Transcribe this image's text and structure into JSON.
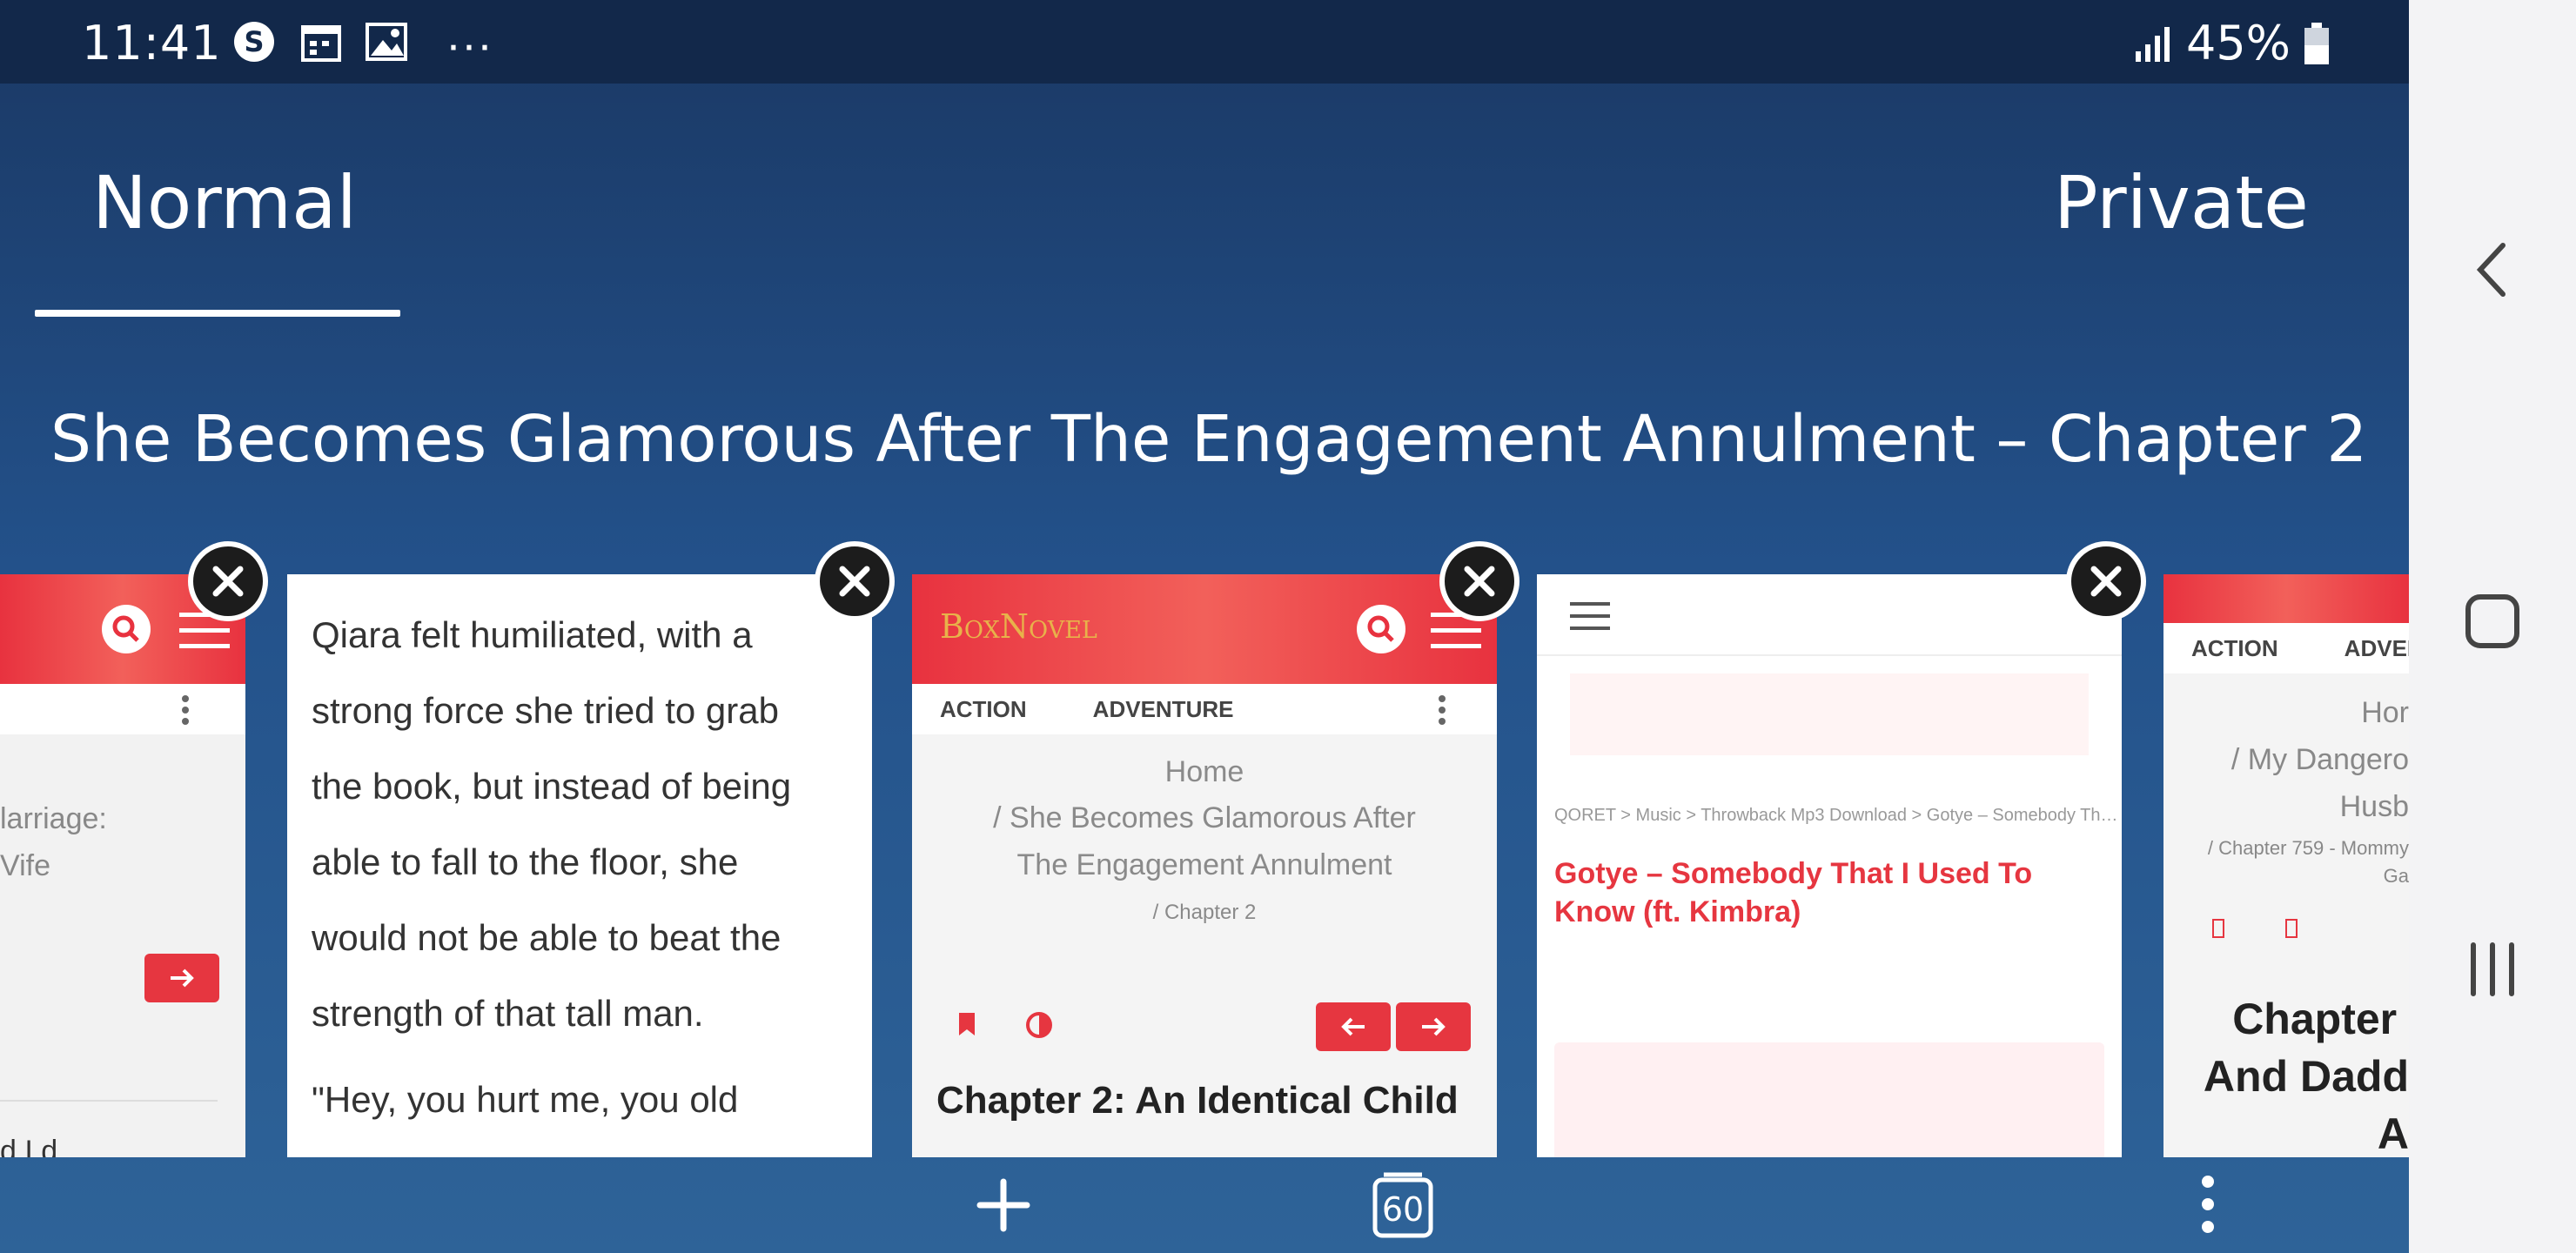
{
  "status": {
    "time": "11:41",
    "battery": "45%"
  },
  "tabs": {
    "normal": "Normal",
    "private": "Private"
  },
  "active_tab_title": "She Becomes Glamorous After The Engagement Annulment – Chapter 2…",
  "card1": {
    "text1": "larriage:",
    "text2": "Vife",
    "text3": "d I d"
  },
  "card2": {
    "lines": [
      "Qiara felt humiliated, with a",
      "strong force she tried to grab",
      "the book, but instead of being",
      "able to fall to the floor, she",
      "would not be able to beat the",
      "strength of that tall man."
    ],
    "next": "\"Hey, you hurt me, you old"
  },
  "card3": {
    "logo": "BoxNovel",
    "cat1": "ACTION",
    "cat2": "ADVENTURE",
    "crumb_home": "Home",
    "crumb_book": "/ She Becomes Glamorous After The Engagement Annulment",
    "crumb_chapter": "/  Chapter 2",
    "heading": "Chapter 2: An Identical Child"
  },
  "card4": {
    "breadcrumb": "QORET > Music > Throwback Mp3 Download > Gotye – Somebody Th…",
    "headline": "Gotye – Somebody That I Used To Know (ft. Kimbra)"
  },
  "card5": {
    "cat1": "ACTION",
    "cat2": "ADVEN",
    "home": "Hor",
    "crumb1": "/ My Dangero",
    "crumb2": "Husb",
    "crumb3": "/  Chapter 759 - Mommy",
    "crumb4": "Ga",
    "heading": "Chapter \nAnd Dadd\nA"
  },
  "bottom": {
    "tab_count": "60"
  },
  "colors": {
    "accent": "#e63640",
    "bg": "#23518a"
  }
}
